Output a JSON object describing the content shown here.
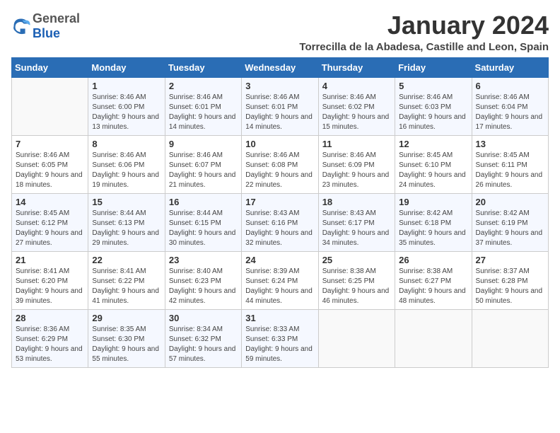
{
  "header": {
    "logo": {
      "general": "General",
      "blue": "Blue"
    },
    "title": "January 2024",
    "location": "Torrecilla de la Abadesa, Castille and Leon, Spain"
  },
  "calendar": {
    "days_of_week": [
      "Sunday",
      "Monday",
      "Tuesday",
      "Wednesday",
      "Thursday",
      "Friday",
      "Saturday"
    ],
    "weeks": [
      [
        {
          "day": "",
          "sunrise": "",
          "sunset": "",
          "daylight": ""
        },
        {
          "day": "1",
          "sunrise": "Sunrise: 8:46 AM",
          "sunset": "Sunset: 6:00 PM",
          "daylight": "Daylight: 9 hours and 13 minutes."
        },
        {
          "day": "2",
          "sunrise": "Sunrise: 8:46 AM",
          "sunset": "Sunset: 6:01 PM",
          "daylight": "Daylight: 9 hours and 14 minutes."
        },
        {
          "day": "3",
          "sunrise": "Sunrise: 8:46 AM",
          "sunset": "Sunset: 6:01 PM",
          "daylight": "Daylight: 9 hours and 14 minutes."
        },
        {
          "day": "4",
          "sunrise": "Sunrise: 8:46 AM",
          "sunset": "Sunset: 6:02 PM",
          "daylight": "Daylight: 9 hours and 15 minutes."
        },
        {
          "day": "5",
          "sunrise": "Sunrise: 8:46 AM",
          "sunset": "Sunset: 6:03 PM",
          "daylight": "Daylight: 9 hours and 16 minutes."
        },
        {
          "day": "6",
          "sunrise": "Sunrise: 8:46 AM",
          "sunset": "Sunset: 6:04 PM",
          "daylight": "Daylight: 9 hours and 17 minutes."
        }
      ],
      [
        {
          "day": "7",
          "sunrise": "Sunrise: 8:46 AM",
          "sunset": "Sunset: 6:05 PM",
          "daylight": "Daylight: 9 hours and 18 minutes."
        },
        {
          "day": "8",
          "sunrise": "Sunrise: 8:46 AM",
          "sunset": "Sunset: 6:06 PM",
          "daylight": "Daylight: 9 hours and 19 minutes."
        },
        {
          "day": "9",
          "sunrise": "Sunrise: 8:46 AM",
          "sunset": "Sunset: 6:07 PM",
          "daylight": "Daylight: 9 hours and 21 minutes."
        },
        {
          "day": "10",
          "sunrise": "Sunrise: 8:46 AM",
          "sunset": "Sunset: 6:08 PM",
          "daylight": "Daylight: 9 hours and 22 minutes."
        },
        {
          "day": "11",
          "sunrise": "Sunrise: 8:46 AM",
          "sunset": "Sunset: 6:09 PM",
          "daylight": "Daylight: 9 hours and 23 minutes."
        },
        {
          "day": "12",
          "sunrise": "Sunrise: 8:45 AM",
          "sunset": "Sunset: 6:10 PM",
          "daylight": "Daylight: 9 hours and 24 minutes."
        },
        {
          "day": "13",
          "sunrise": "Sunrise: 8:45 AM",
          "sunset": "Sunset: 6:11 PM",
          "daylight": "Daylight: 9 hours and 26 minutes."
        }
      ],
      [
        {
          "day": "14",
          "sunrise": "Sunrise: 8:45 AM",
          "sunset": "Sunset: 6:12 PM",
          "daylight": "Daylight: 9 hours and 27 minutes."
        },
        {
          "day": "15",
          "sunrise": "Sunrise: 8:44 AM",
          "sunset": "Sunset: 6:13 PM",
          "daylight": "Daylight: 9 hours and 29 minutes."
        },
        {
          "day": "16",
          "sunrise": "Sunrise: 8:44 AM",
          "sunset": "Sunset: 6:15 PM",
          "daylight": "Daylight: 9 hours and 30 minutes."
        },
        {
          "day": "17",
          "sunrise": "Sunrise: 8:43 AM",
          "sunset": "Sunset: 6:16 PM",
          "daylight": "Daylight: 9 hours and 32 minutes."
        },
        {
          "day": "18",
          "sunrise": "Sunrise: 8:43 AM",
          "sunset": "Sunset: 6:17 PM",
          "daylight": "Daylight: 9 hours and 34 minutes."
        },
        {
          "day": "19",
          "sunrise": "Sunrise: 8:42 AM",
          "sunset": "Sunset: 6:18 PM",
          "daylight": "Daylight: 9 hours and 35 minutes."
        },
        {
          "day": "20",
          "sunrise": "Sunrise: 8:42 AM",
          "sunset": "Sunset: 6:19 PM",
          "daylight": "Daylight: 9 hours and 37 minutes."
        }
      ],
      [
        {
          "day": "21",
          "sunrise": "Sunrise: 8:41 AM",
          "sunset": "Sunset: 6:20 PM",
          "daylight": "Daylight: 9 hours and 39 minutes."
        },
        {
          "day": "22",
          "sunrise": "Sunrise: 8:41 AM",
          "sunset": "Sunset: 6:22 PM",
          "daylight": "Daylight: 9 hours and 41 minutes."
        },
        {
          "day": "23",
          "sunrise": "Sunrise: 8:40 AM",
          "sunset": "Sunset: 6:23 PM",
          "daylight": "Daylight: 9 hours and 42 minutes."
        },
        {
          "day": "24",
          "sunrise": "Sunrise: 8:39 AM",
          "sunset": "Sunset: 6:24 PM",
          "daylight": "Daylight: 9 hours and 44 minutes."
        },
        {
          "day": "25",
          "sunrise": "Sunrise: 8:38 AM",
          "sunset": "Sunset: 6:25 PM",
          "daylight": "Daylight: 9 hours and 46 minutes."
        },
        {
          "day": "26",
          "sunrise": "Sunrise: 8:38 AM",
          "sunset": "Sunset: 6:27 PM",
          "daylight": "Daylight: 9 hours and 48 minutes."
        },
        {
          "day": "27",
          "sunrise": "Sunrise: 8:37 AM",
          "sunset": "Sunset: 6:28 PM",
          "daylight": "Daylight: 9 hours and 50 minutes."
        }
      ],
      [
        {
          "day": "28",
          "sunrise": "Sunrise: 8:36 AM",
          "sunset": "Sunset: 6:29 PM",
          "daylight": "Daylight: 9 hours and 53 minutes."
        },
        {
          "day": "29",
          "sunrise": "Sunrise: 8:35 AM",
          "sunset": "Sunset: 6:30 PM",
          "daylight": "Daylight: 9 hours and 55 minutes."
        },
        {
          "day": "30",
          "sunrise": "Sunrise: 8:34 AM",
          "sunset": "Sunset: 6:32 PM",
          "daylight": "Daylight: 9 hours and 57 minutes."
        },
        {
          "day": "31",
          "sunrise": "Sunrise: 8:33 AM",
          "sunset": "Sunset: 6:33 PM",
          "daylight": "Daylight: 9 hours and 59 minutes."
        },
        {
          "day": "",
          "sunrise": "",
          "sunset": "",
          "daylight": ""
        },
        {
          "day": "",
          "sunrise": "",
          "sunset": "",
          "daylight": ""
        },
        {
          "day": "",
          "sunrise": "",
          "sunset": "",
          "daylight": ""
        }
      ]
    ]
  }
}
